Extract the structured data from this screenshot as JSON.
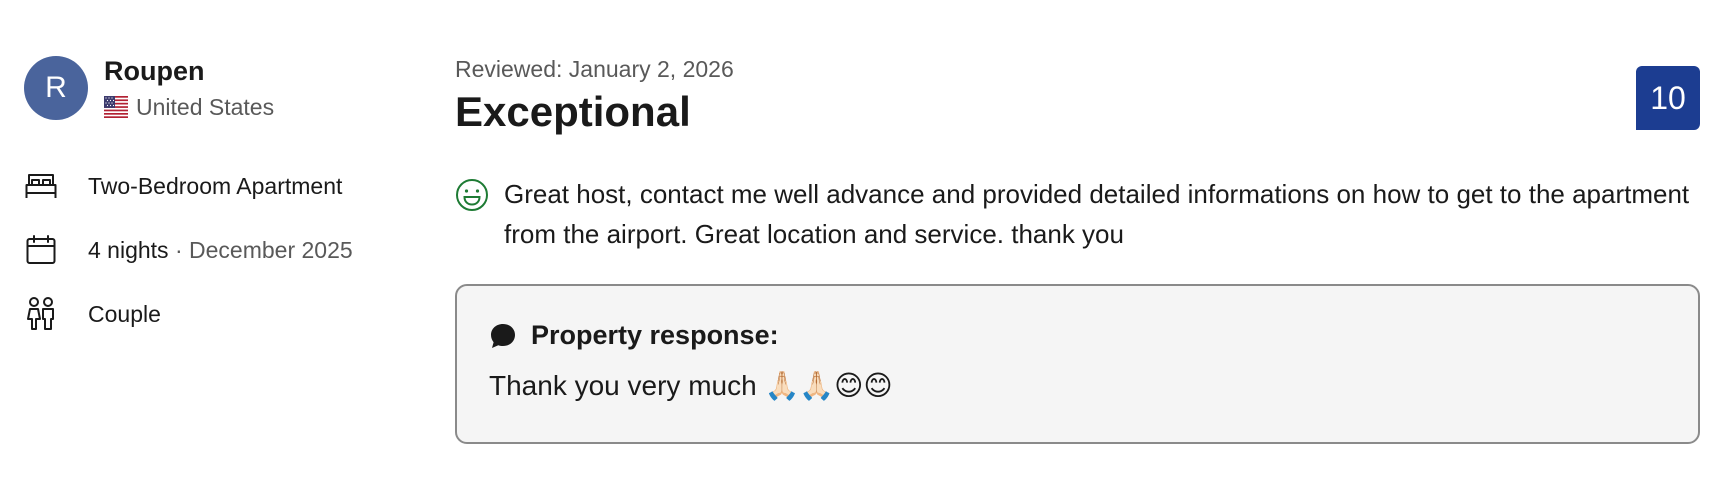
{
  "reviewer": {
    "initial": "R",
    "name": "Roupen",
    "country": "United States",
    "flag_icon": "us-flag-icon",
    "avatar_color": "#4a649c"
  },
  "stay": {
    "room": "Two-Bedroom Apartment",
    "nights": "4 nights",
    "separator": " · ",
    "month": "December 2025",
    "traveler_type": "Couple",
    "icons": [
      "bed-icon",
      "calendar-icon",
      "couple-icon"
    ]
  },
  "review": {
    "reviewed_date": "Reviewed: January 2, 2026",
    "title": "Exceptional",
    "score": "10",
    "score_color": "#1c3d91",
    "text": "Great host, contact me well advance and provided detailed informations on how to get to the apartment from the airport. Great location and service. thank you",
    "sentiment_icon": "smile-icon",
    "sentiment_color": "#1e7b34"
  },
  "response": {
    "label": "Property response:",
    "text": "Thank you very much 🙏🏻🙏🏻😊😊",
    "icon": "chat-bubble-icon"
  }
}
